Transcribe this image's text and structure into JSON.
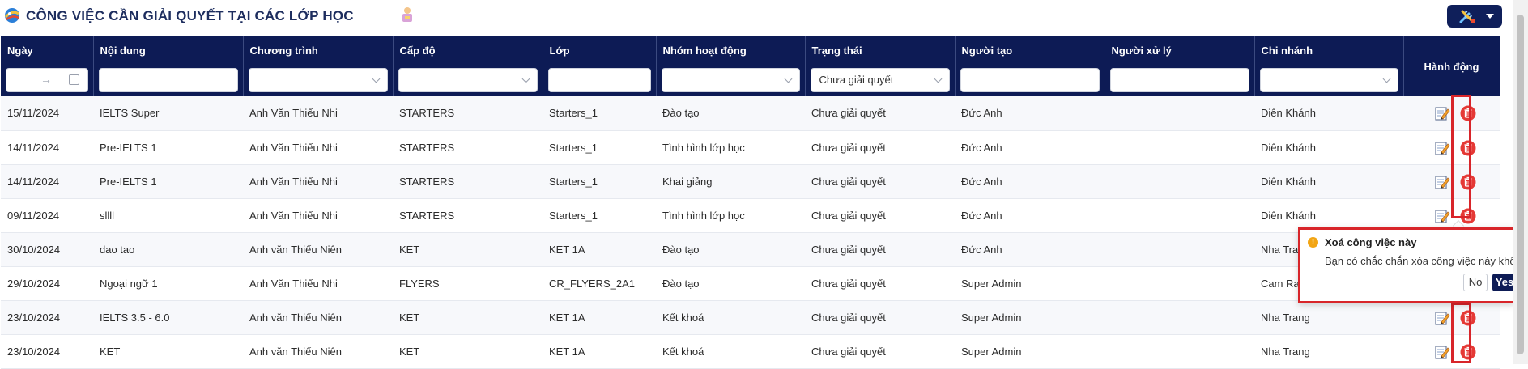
{
  "header": {
    "title": "CÔNG VIỆC CẦN GIẢI QUYẾT TẠI CÁC LỚP HỌC",
    "app_logo_icon": "colorful-ball-logo",
    "title_emoji_icon": "person-emoji-icon",
    "tools_icon": "tools-icon"
  },
  "colors": {
    "header_bg": "#0d1b55",
    "highlight": "#d8252a",
    "warning": "#f2a514"
  },
  "table": {
    "columns": [
      "Ngày",
      "Nội dung",
      "Chương trình",
      "Cấp độ",
      "Lớp",
      "Nhóm hoạt động",
      "Trạng thái",
      "Người tạo",
      "Người xử lý",
      "Chi nhánh",
      "Hành động"
    ],
    "filters": {
      "status_selected": "Chưa giải quyết",
      "date_arrow": "→"
    },
    "rows": [
      [
        "15/11/2024",
        "IELTS Super",
        "Anh Văn Thiếu Nhi",
        "STARTERS",
        "Starters_1",
        "Đào tạo",
        "Chưa giải quyết",
        "Đức Anh",
        "",
        "Diên Khánh"
      ],
      [
        "14/11/2024",
        "Pre-IELTS 1",
        "Anh Văn Thiếu Nhi",
        "STARTERS",
        "Starters_1",
        "Tình hình lớp học",
        "Chưa giải quyết",
        "Đức Anh",
        "",
        "Diên Khánh"
      ],
      [
        "14/11/2024",
        "Pre-IELTS 1",
        "Anh Văn Thiếu Nhi",
        "STARTERS",
        "Starters_1",
        "Khai giảng",
        "Chưa giải quyết",
        "Đức Anh",
        "",
        "Diên Khánh"
      ],
      [
        "09/11/2024",
        "sllll",
        "Anh Văn Thiếu Nhi",
        "STARTERS",
        "Starters_1",
        "Tình hình lớp học",
        "Chưa giải quyết",
        "Đức Anh",
        "",
        "Diên Khánh"
      ],
      [
        "30/10/2024",
        "dao tao",
        "Anh văn Thiếu Niên",
        "KET",
        "KET 1A",
        "Đào tạo",
        "Chưa giải quyết",
        "Đức Anh",
        "",
        "Nha Trang"
      ],
      [
        "29/10/2024",
        "Ngoại ngữ 1",
        "Anh Văn Thiếu Nhi",
        "FLYERS",
        "CR_FLYERS_2A1",
        "Đào tạo",
        "Chưa giải quyết",
        "Super Admin",
        "",
        "Cam Ranh"
      ],
      [
        "23/10/2024",
        "IELTS 3.5 - 6.0",
        "Anh văn Thiếu Niên",
        "KET",
        "KET 1A",
        "Kết khoá",
        "Chưa giải quyết",
        "Super Admin",
        "",
        "Nha Trang"
      ],
      [
        "23/10/2024",
        "KET",
        "Anh văn Thiếu Niên",
        "KET",
        "KET 1A",
        "Kết khoá",
        "Chưa giải quyết",
        "Super Admin",
        "",
        "Nha Trang"
      ]
    ],
    "row_action_icons": [
      "edit-icon",
      "delete-icon"
    ]
  },
  "popconfirm": {
    "title": "Xoá công việc này",
    "message": "Bạn có chắc chắn xóa công việc này không?",
    "no_label": "No",
    "yes_label": "Yes",
    "warn_glyph": "!"
  }
}
